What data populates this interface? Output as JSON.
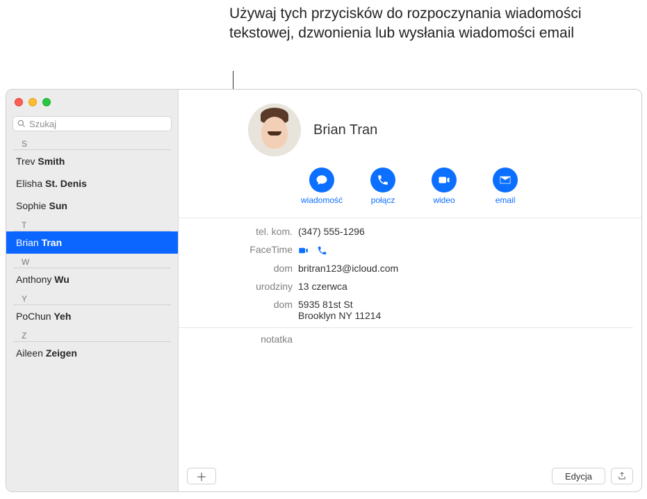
{
  "annotation": "Używaj tych przycisków do rozpoczynania wiadomości tekstowej, dzwonienia lub wysłania wiadomości email",
  "search": {
    "placeholder": "Szukaj"
  },
  "sections": {
    "s": "S",
    "t": "T",
    "w": "W",
    "y": "Y",
    "z": "Z"
  },
  "contacts": {
    "s0_first": "Trev",
    "s0_last": "Smith",
    "s1_first": "Elisha",
    "s1_last": "St. Denis",
    "s2_first": "Sophie",
    "s2_last": "Sun",
    "t0_first": "Brian",
    "t0_last": "Tran",
    "w0_first": "Anthony",
    "w0_last": "Wu",
    "y0_first": "PoChun",
    "y0_last": "Yeh",
    "z0_first": "Aileen",
    "z0_last": "Zeigen"
  },
  "contact": {
    "name": "Brian Tran"
  },
  "actions": {
    "message": "wiadomość",
    "call": "połącz",
    "video": "wideo",
    "email": "email"
  },
  "fields": {
    "mobile_label": "tel. kom.",
    "mobile_value": "(347) 555-1296",
    "facetime_label": "FaceTime",
    "home_email_label": "dom",
    "home_email_value": "britran123@icloud.com",
    "birthday_label": "urodziny",
    "birthday_value": "13 czerwca",
    "home_addr_label": "dom",
    "home_addr_line1": "5935 81st St",
    "home_addr_line2": "Brooklyn NY 11214",
    "note_label": "notatka"
  },
  "buttons": {
    "edit": "Edycja"
  }
}
